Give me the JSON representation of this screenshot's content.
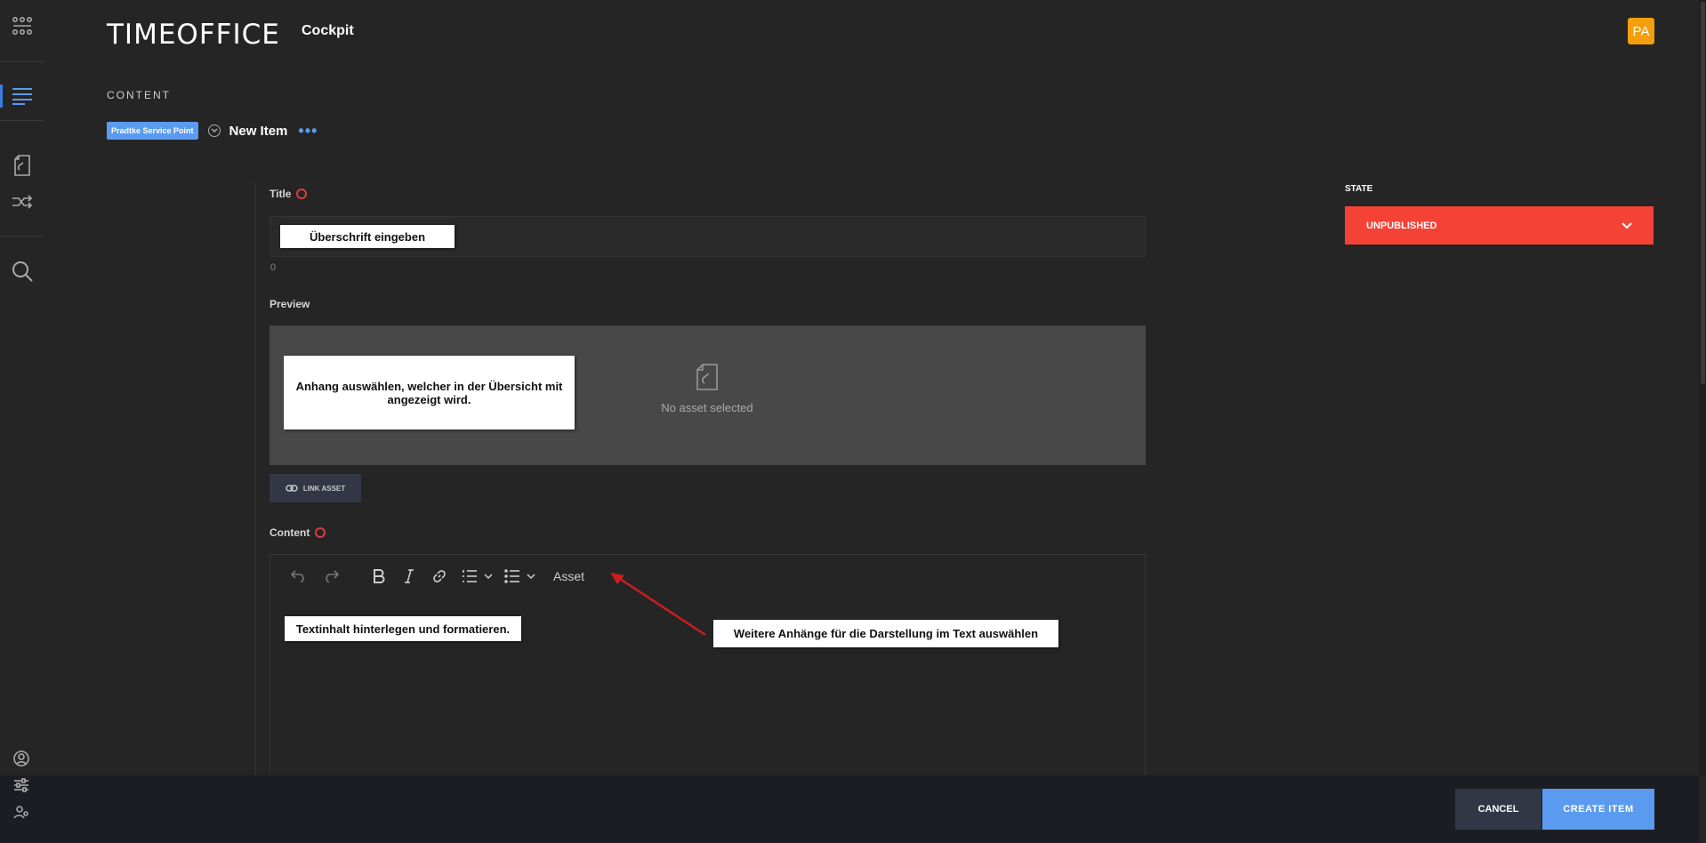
{
  "header": {
    "logo": "TIMEOFFICE",
    "logo_sub": "Cockpit",
    "avatar_initials": "PA"
  },
  "section_label": "CONTENT",
  "breadcrumb": {
    "badge": "Pradtke Service Point",
    "title": "New Item",
    "more": "•••"
  },
  "form": {
    "title_label": "Title",
    "title_count": "0",
    "preview_label": "Preview",
    "no_asset_text": "No asset selected",
    "link_asset_label": "LINK ASSET",
    "content_label": "Content",
    "toolbar_asset": "Asset"
  },
  "annotations": {
    "title_hint": "Überschrift eingeben",
    "preview_hint": "Anhang auswählen, welcher in der Übersicht mit angezeigt wird.",
    "content_hint": "Textinhalt hinterlegen und formatieren.",
    "asset_hint": "Weitere Anhänge für die Darstellung im Text auswählen"
  },
  "state": {
    "label": "STATE",
    "value": "UNPUBLISHED"
  },
  "actions": {
    "cancel": "CANCEL",
    "create": "CREATE ITEM"
  },
  "colors": {
    "accent": "#5b9bef",
    "state_red": "#f44336",
    "avatar": "#f59e0b",
    "arrow": "#d01c1c"
  }
}
